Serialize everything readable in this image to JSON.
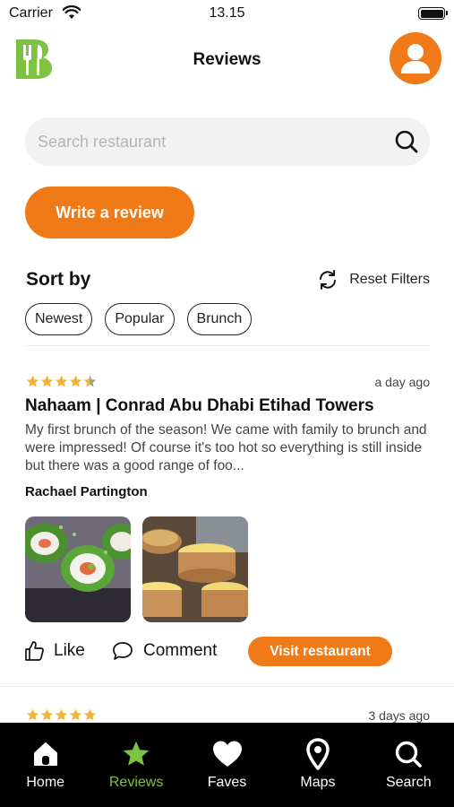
{
  "status_bar": {
    "carrier": "Carrier",
    "time": "13.15"
  },
  "header": {
    "title": "Reviews",
    "logo_letter": "B"
  },
  "search": {
    "placeholder": "Search restaurant",
    "value": ""
  },
  "write_review_label": "Write a review",
  "sort": {
    "title": "Sort by",
    "reset_label": "Reset Filters",
    "chips": [
      "Newest",
      "Popular",
      "Brunch"
    ]
  },
  "reviews": [
    {
      "rating": 4.5,
      "time_ago": "a day ago",
      "restaurant": "Nahaam | Conrad Abu Dhabi Etihad Towers",
      "text": "My first brunch of the season! We came with family to brunch and were impressed! Of course it's too hot so everything is still inside but there was a good range of foo...",
      "author": "Rachael Partington",
      "photos": [
        "sushi-rolls-photo",
        "custard-tarts-photo"
      ],
      "like_label": "Like",
      "comment_label": "Comment",
      "visit_label": "Visit restaurant"
    },
    {
      "rating": 5,
      "time_ago": "3 days ago"
    }
  ],
  "tabs": [
    {
      "label": "Home",
      "icon": "home-icon",
      "active": false
    },
    {
      "label": "Reviews",
      "icon": "star-icon",
      "active": true
    },
    {
      "label": "Faves",
      "icon": "heart-icon",
      "active": false
    },
    {
      "label": "Maps",
      "icon": "map-pin-icon",
      "active": false
    },
    {
      "label": "Search",
      "icon": "search-icon",
      "active": false
    }
  ],
  "colors": {
    "accent": "#ef7a17",
    "brand_green": "#7fc242",
    "star": "#f7b228",
    "tab_bar": "#000000"
  }
}
